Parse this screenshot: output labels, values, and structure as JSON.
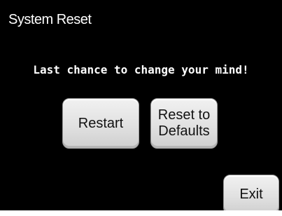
{
  "dialog": {
    "title": "System Reset",
    "message": "Last chance to change your mind!"
  },
  "buttons": {
    "restart": "Restart",
    "reset_to_defaults": "Reset to\nDefaults",
    "exit": "Exit"
  },
  "colors": {
    "screen_background": "#000000",
    "text": "#ffffff",
    "button_face": "#e1e1e1",
    "button_text": "#111111"
  }
}
